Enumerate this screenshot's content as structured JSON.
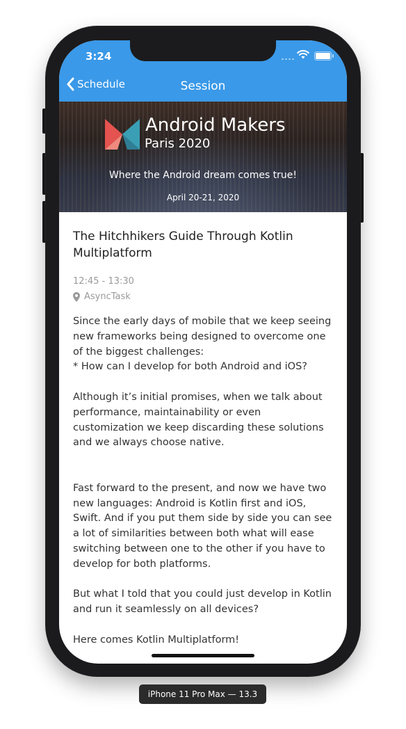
{
  "status_bar": {
    "time": "3:24"
  },
  "nav": {
    "back_label": "Schedule",
    "title": "Session"
  },
  "banner": {
    "title": "Android Makers",
    "subtitle": "Paris 2020",
    "tagline": "Where the Android dream comes true!",
    "date": "April 20-21, 2020"
  },
  "session": {
    "title": "The Hitchhikers Guide Through Kotlin Multiplatform",
    "time": "12:45 - 13:30",
    "room": "AsyncTask",
    "description": [
      "Since the early days of mobile that we keep seeing new frameworks being designed to overcome one of the biggest challenges:",
      "* How can I develop for both Android and iOS?",
      "",
      "Although it’s initial promises, when we talk about performance, maintainability or even customization we keep discarding these solutions and we always choose native.",
      "",
      "",
      "Fast forward to the present, and now we have two new languages: Android is Kotlin first and iOS, Swift. And if you put them side by side you can see a lot of similarities between both what will ease switching between one to the other if you have to develop for both platforms.",
      "",
      "But what I told that you could just develop in Kotlin and run it seamlessly on all devices?",
      "",
      "Here comes Kotlin Multiplatform!"
    ]
  },
  "device_label": "iPhone 11 Pro Max — 13.3",
  "colors": {
    "accent": "#3a99e8",
    "device": "#1b1b1d",
    "logo_red": "#e4534f",
    "logo_teal": "#3a9fb4"
  }
}
